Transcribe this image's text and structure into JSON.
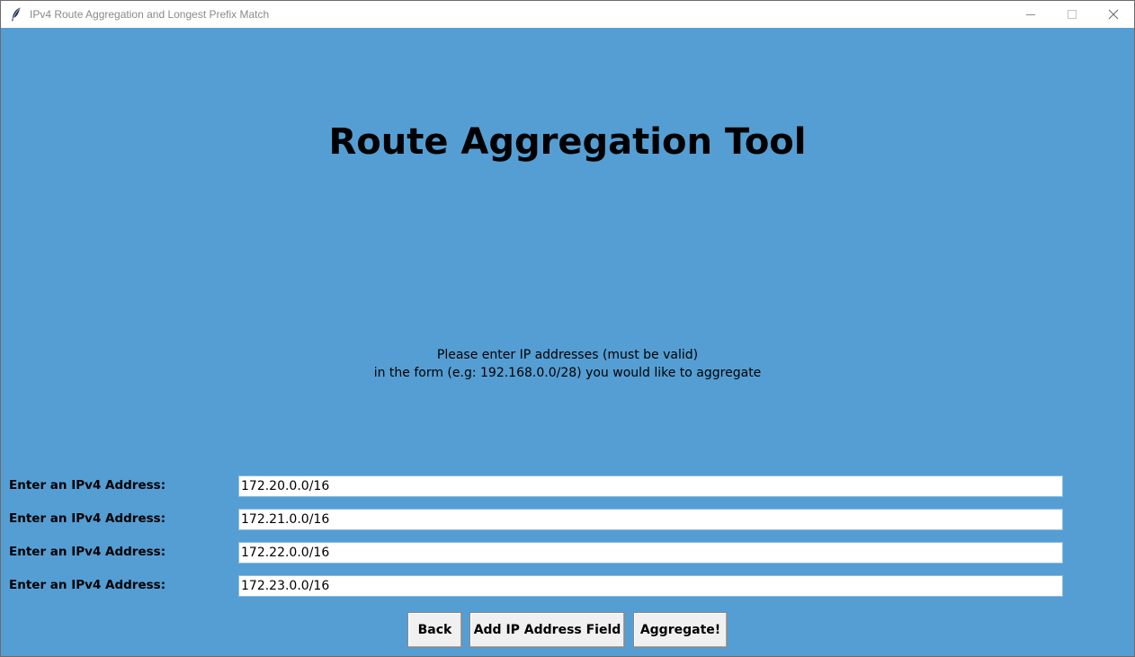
{
  "window": {
    "title": "IPv4 Route Aggregation and Longest Prefix Match",
    "app_icon": "feather-icon",
    "controls": [
      "minimize-icon",
      "maximize-icon",
      "close-icon"
    ]
  },
  "main": {
    "heading": "Route Aggregation Tool",
    "instructions": [
      "Please enter IP addresses (must be valid)",
      "in the form (e.g: 192.168.0.0/28) you would like to aggregate"
    ],
    "fields": [
      {
        "label": "Enter an IPv4 Address:",
        "value": "172.20.0.0/16"
      },
      {
        "label": "Enter an IPv4 Address:",
        "value": "172.21.0.0/16"
      },
      {
        "label": "Enter an IPv4 Address:",
        "value": "172.22.0.0/16"
      },
      {
        "label": "Enter an IPv4 Address:",
        "value": "172.23.0.0/16"
      }
    ],
    "buttons": {
      "back": "Back",
      "add_field": "Add IP Address Field",
      "aggregate": "Aggregate!"
    }
  },
  "colors": {
    "background": "#559ed3",
    "titlebar": "#ffffff",
    "button_face": "#f0f0f0"
  }
}
